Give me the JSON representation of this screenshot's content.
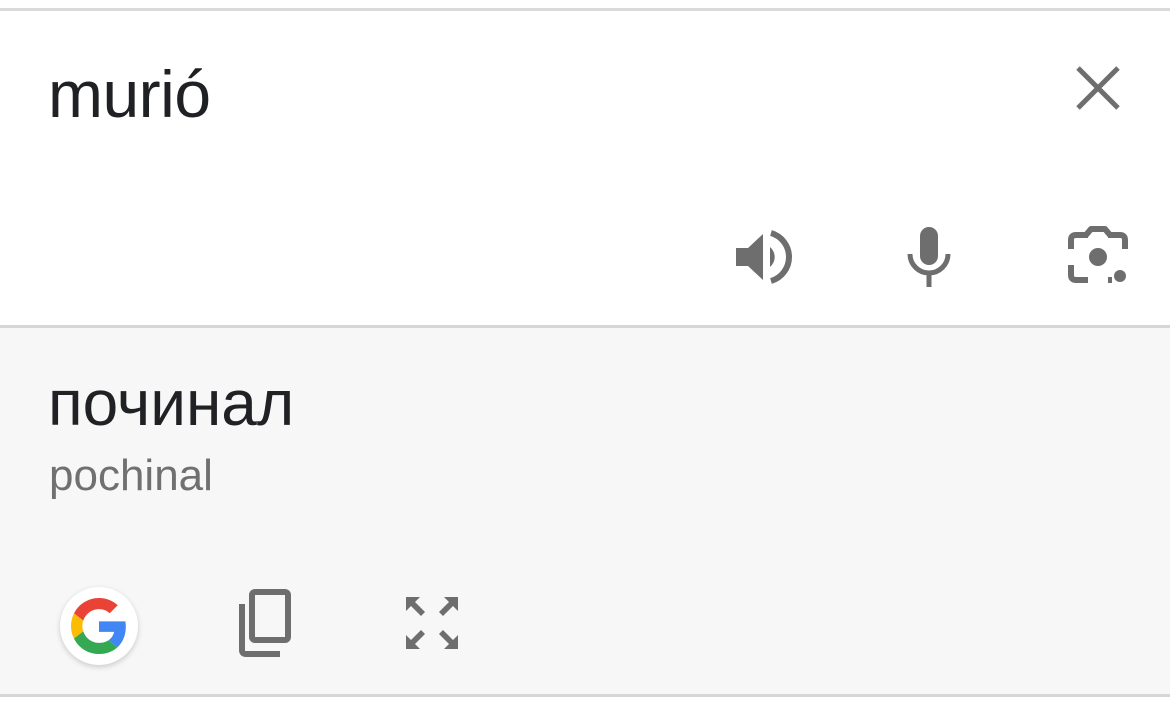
{
  "input": {
    "source_text": "murió",
    "icons": {
      "clear": "close-icon",
      "listen": "speaker-icon",
      "voice": "microphone-icon",
      "camera": "camera-icon"
    }
  },
  "output": {
    "translation": "починал",
    "transliteration": "pochinal",
    "icons": {
      "google": "google-logo-icon",
      "copy": "copy-icon",
      "fullscreen": "fullscreen-icon"
    }
  },
  "colors": {
    "icon_gray": "#6e6e6e",
    "text_primary": "#202124",
    "text_secondary": "#707070",
    "output_background": "#f7f7f7",
    "divider": "#d6d6d6"
  }
}
